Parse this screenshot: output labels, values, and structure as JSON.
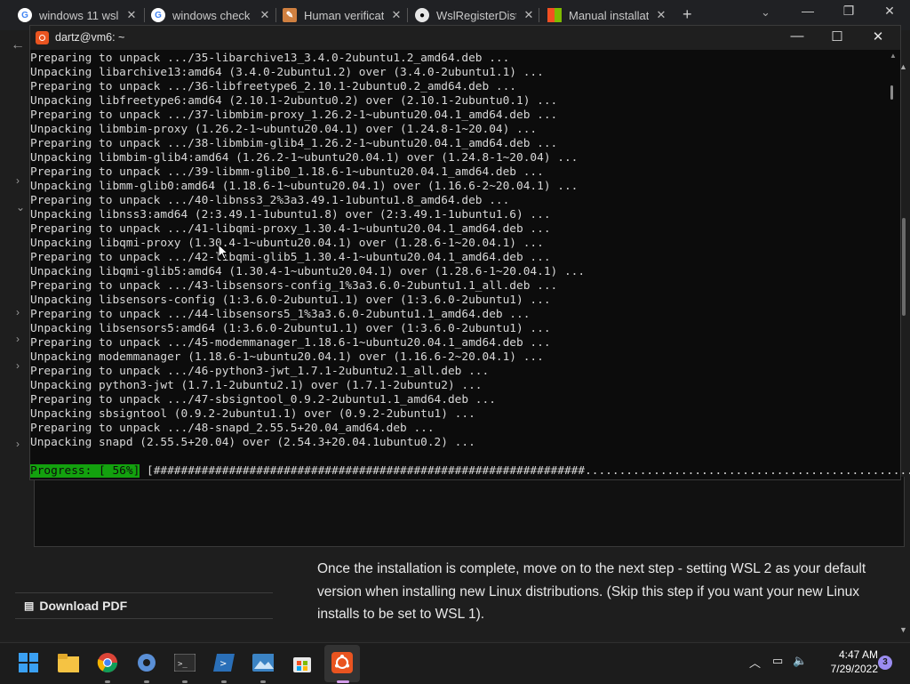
{
  "browser": {
    "tabs": [
      {
        "title": "windows 11 wsl",
        "icon": "google-icon"
      },
      {
        "title": "windows check",
        "icon": "google-icon"
      },
      {
        "title": "Human verificat",
        "icon": "pencil-icon"
      },
      {
        "title": "WslRegisterDist",
        "icon": "github-icon"
      },
      {
        "title": "Manual installat",
        "icon": "microsoft-icon"
      }
    ],
    "close_glyph": "✕",
    "new_tab_glyph": "+",
    "controls": {
      "minimize": "—",
      "restore": "❐",
      "close": "✕"
    }
  },
  "terminal": {
    "title": "dartz@vm6: ~",
    "controls": {
      "minimize": "—",
      "maximize": "☐",
      "close": "✕"
    },
    "lines": [
      "Preparing to unpack .../35-libarchive13_3.4.0-2ubuntu1.2_amd64.deb ...",
      "Unpacking libarchive13:amd64 (3.4.0-2ubuntu1.2) over (3.4.0-2ubuntu1.1) ...",
      "Preparing to unpack .../36-libfreetype6_2.10.1-2ubuntu0.2_amd64.deb ...",
      "Unpacking libfreetype6:amd64 (2.10.1-2ubuntu0.2) over (2.10.1-2ubuntu0.1) ...",
      "Preparing to unpack .../37-libmbim-proxy_1.26.2-1~ubuntu20.04.1_amd64.deb ...",
      "Unpacking libmbim-proxy (1.26.2-1~ubuntu20.04.1) over (1.24.8-1~20.04) ...",
      "Preparing to unpack .../38-libmbim-glib4_1.26.2-1~ubuntu20.04.1_amd64.deb ...",
      "Unpacking libmbim-glib4:amd64 (1.26.2-1~ubuntu20.04.1) over (1.24.8-1~20.04) ...",
      "Preparing to unpack .../39-libmm-glib0_1.18.6-1~ubuntu20.04.1_amd64.deb ...",
      "Unpacking libmm-glib0:amd64 (1.18.6-1~ubuntu20.04.1) over (1.16.6-2~20.04.1) ...",
      "Preparing to unpack .../40-libnss3_2%3a3.49.1-1ubuntu1.8_amd64.deb ...",
      "Unpacking libnss3:amd64 (2:3.49.1-1ubuntu1.8) over (2:3.49.1-1ubuntu1.6) ...",
      "Preparing to unpack .../41-libqmi-proxy_1.30.4-1~ubuntu20.04.1_amd64.deb ...",
      "Unpacking libqmi-proxy (1.30.4-1~ubuntu20.04.1) over (1.28.6-1~20.04.1) ...",
      "Preparing to unpack .../42-libqmi-glib5_1.30.4-1~ubuntu20.04.1_amd64.deb ...",
      "Unpacking libqmi-glib5:amd64 (1.30.4-1~ubuntu20.04.1) over (1.28.6-1~20.04.1) ...",
      "Preparing to unpack .../43-libsensors-config_1%3a3.6.0-2ubuntu1.1_all.deb ...",
      "Unpacking libsensors-config (1:3.6.0-2ubuntu1.1) over (1:3.6.0-2ubuntu1) ...",
      "Preparing to unpack .../44-libsensors5_1%3a3.6.0-2ubuntu1.1_amd64.deb ...",
      "Unpacking libsensors5:amd64 (1:3.6.0-2ubuntu1.1) over (1:3.6.0-2ubuntu1) ...",
      "Preparing to unpack .../45-modemmanager_1.18.6-1~ubuntu20.04.1_amd64.deb ...",
      "Unpacking modemmanager (1.18.6-1~ubuntu20.04.1) over (1.16.6-2~20.04.1) ...",
      "Preparing to unpack .../46-python3-jwt_1.7.1-2ubuntu2.1_all.deb ...",
      "Unpacking python3-jwt (1.7.1-2ubuntu2.1) over (1.7.1-2ubuntu2) ...",
      "Preparing to unpack .../47-sbsigntool_0.9.2-2ubuntu1.1_amd64.deb ...",
      "Unpacking sbsigntool (0.9.2-2ubuntu1.1) over (0.9.2-2ubuntu1) ...",
      "Preparing to unpack .../48-snapd_2.55.5+20.04_amd64.deb ...",
      "Unpacking snapd (2.55.5+20.04) over (2.54.3+20.04.1ubuntu0.2) ..."
    ],
    "progress_label": "Progress: [ 56%]",
    "progress_bar": " [###############################################################.................................................]",
    "progress_fraction": 0.56
  },
  "article": {
    "paragraph": "Once the installation is complete, move on to the next step - setting WSL 2 as your default version when installing new Linux distributions. (Skip this step if you want your new Linux installs to be set to WSL 1)."
  },
  "sidebar": {
    "download_pdf": "Download PDF"
  },
  "taskbar": {
    "apps": [
      "start-icon",
      "file-explorer-icon",
      "chrome-icon",
      "settings-icon",
      "terminal-icon",
      "powershell-icon",
      "photos-icon",
      "store-icon",
      "ubuntu-icon"
    ],
    "time": "4:47 AM",
    "date": "7/29/2022",
    "notifications": "3"
  }
}
